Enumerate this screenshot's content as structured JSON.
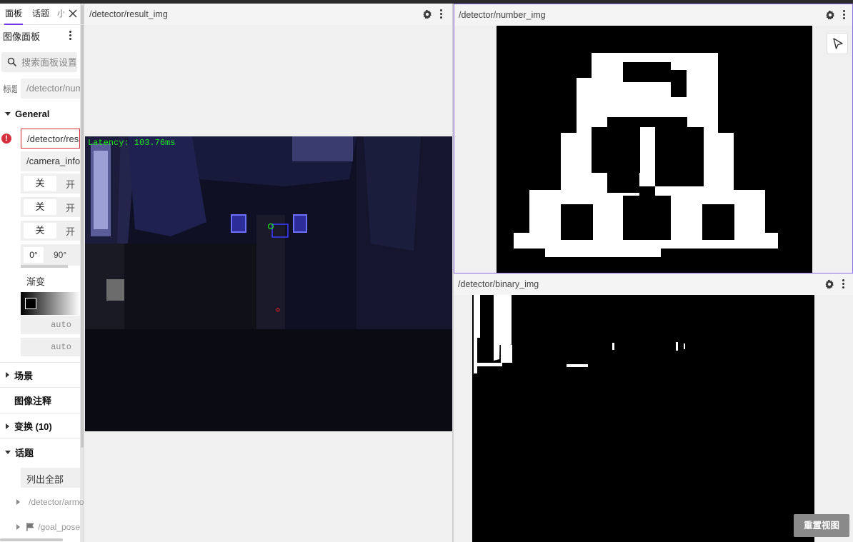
{
  "sidebar": {
    "tabs": [
      "面板",
      "话题",
      "小"
    ],
    "panel_title": "图像面板",
    "search_placeholder": "搜索面板设置",
    "topic_label": "标题",
    "topic_value": "/detector/number_img",
    "general": {
      "title": "General",
      "image_topic": "/detector/result_img",
      "calibration_topic": "/camera_info",
      "toggles": [
        {
          "on": "关",
          "off": "开"
        },
        {
          "on": "关",
          "off": "开"
        },
        {
          "on": "关",
          "off": "开"
        }
      ],
      "rotation": {
        "selected": "0°",
        "other": "90°"
      },
      "color_mode": "渐变",
      "min_value": "auto",
      "max_value": "auto"
    },
    "sections": {
      "scene": "场景",
      "annotations": "图像注释",
      "transforms": "变换 (10)",
      "topics": "话题"
    },
    "list_all": "列出全部",
    "tree_items": [
      "/detector/armors",
      "/goal_pose"
    ]
  },
  "panels": {
    "result": {
      "title": "/detector/result_img",
      "latency": "Latency: 103.76ms"
    },
    "number": {
      "title": "/detector/number_img"
    },
    "binary": {
      "title": "/detector/binary_img",
      "reset_button": "重置视图"
    }
  },
  "colors": {
    "accent": "#6f3be8",
    "error": "#d6303e",
    "latency_text": "#22e622"
  },
  "icons": [
    "close-icon",
    "search-icon",
    "error-icon",
    "gear-icon",
    "kebab-icon",
    "cursor-icon",
    "topic-icon",
    "flag-icon"
  ]
}
